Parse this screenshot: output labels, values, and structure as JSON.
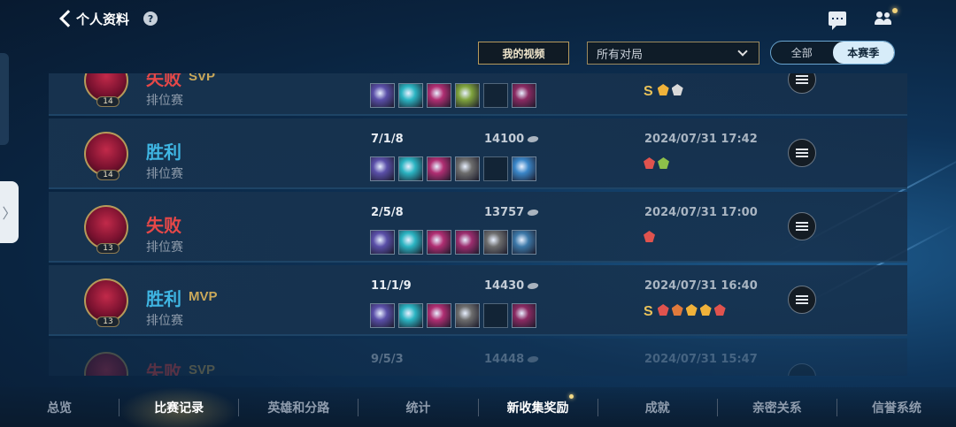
{
  "header": {
    "back_title": "个人资料",
    "help_label": "?"
  },
  "filters": {
    "my_videos_label": "我的视频",
    "match_filter_value": "所有对局",
    "season_all_label": "全部",
    "season_current_label": "本赛季"
  },
  "matches": [
    {
      "result": "失败",
      "result_type": "lose",
      "badge": "SVP",
      "mode": "排位赛",
      "level": "14",
      "kda": "",
      "gold": "",
      "date": "",
      "items": [
        "#5a4fa8",
        "#2bb4c2",
        "#b02e72",
        "#7fa33d",
        "empty",
        "#8a2a62"
      ],
      "honors": [
        "S",
        "#f0b23a",
        "#d9d9d9"
      ]
    },
    {
      "result": "胜利",
      "result_type": "win",
      "badge": "",
      "mode": "排位赛",
      "level": "14",
      "kda": "7/1/8",
      "gold": "14100",
      "date": "2024/07/31 17:42",
      "items": [
        "#5a4fa8",
        "#2bb4c2",
        "#b02e72",
        "#6d6d6d",
        "empty",
        "#3a86c8"
      ],
      "honors": [
        "#e0534e",
        "#8dbf4a"
      ]
    },
    {
      "result": "失败",
      "result_type": "lose",
      "badge": "",
      "mode": "排位赛",
      "level": "13",
      "kda": "2/5/8",
      "gold": "13757",
      "date": "2024/07/31 17:00",
      "items": [
        "#5a4fa8",
        "#2bb4c2",
        "#b02e72",
        "#9c2d6e",
        "#6d6d6d",
        "#3c78a8"
      ],
      "honors": [
        "#e0534e"
      ]
    },
    {
      "result": "胜利",
      "result_type": "win",
      "badge": "MVP",
      "mode": "排位赛",
      "level": "13",
      "kda": "11/1/9",
      "gold": "14430",
      "date": "2024/07/31 16:40",
      "items": [
        "#5a4fa8",
        "#2bb4c2",
        "#b02e72",
        "#6d6d6d",
        "empty",
        "#8a2a62"
      ],
      "honors": [
        "S",
        "#e0534e",
        "#e07a3c",
        "#f0b23a",
        "#f0b23a",
        "#e0534e"
      ]
    },
    {
      "result": "失败",
      "result_type": "lose",
      "badge": "SVP",
      "mode": "",
      "level": "",
      "kda": "9/5/3",
      "gold": "14448",
      "date": "2024/07/31 15:47",
      "items": [],
      "honors": []
    }
  ],
  "tabs": [
    {
      "label": "总览",
      "state": "normal"
    },
    {
      "label": "比赛记录",
      "state": "active"
    },
    {
      "label": "英雄和分路",
      "state": "normal"
    },
    {
      "label": "统计",
      "state": "normal"
    },
    {
      "label": "新收集奖励",
      "state": "highlight"
    },
    {
      "label": "成就",
      "state": "normal"
    },
    {
      "label": "亲密关系",
      "state": "normal"
    },
    {
      "label": "信誉系统",
      "state": "normal"
    }
  ]
}
